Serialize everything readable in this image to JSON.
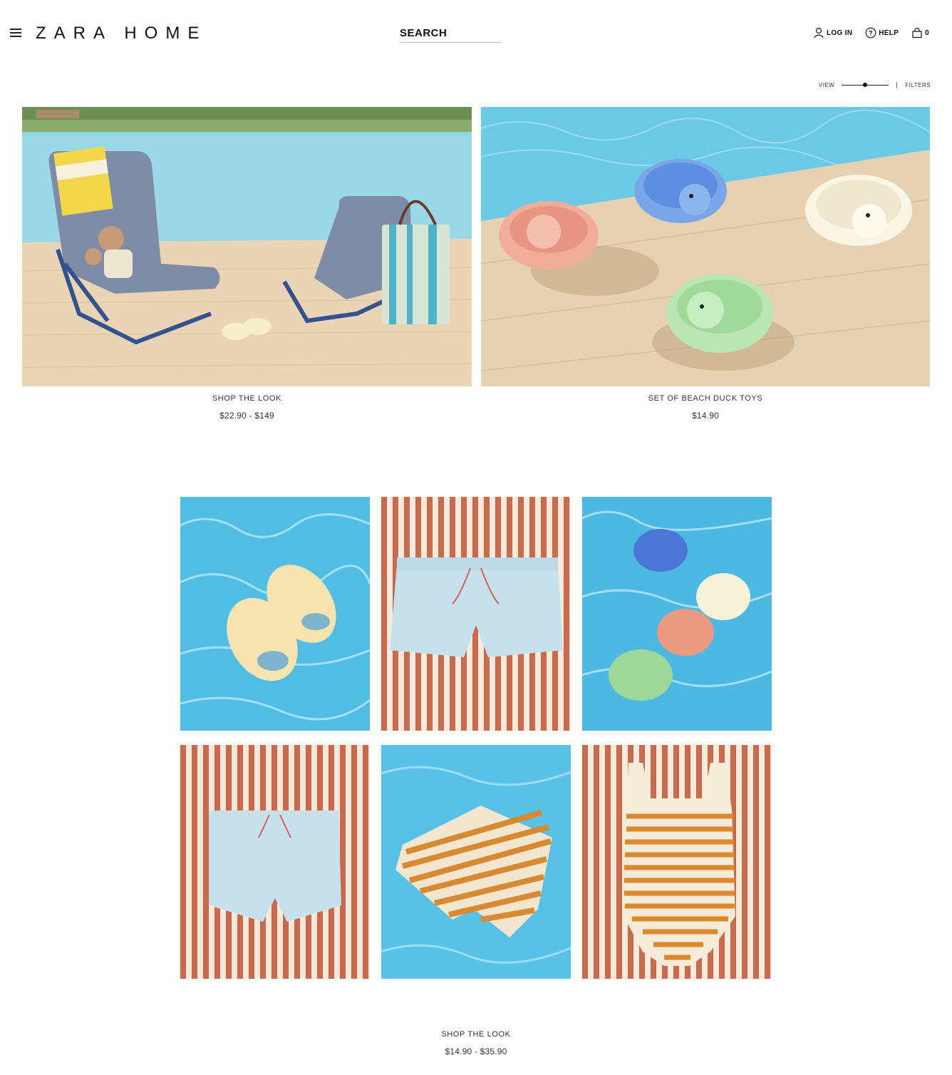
{
  "header": {
    "logo": "ZARA HOME",
    "search_label": "SEARCH",
    "login_label": "LOG IN",
    "help_label": "HELP",
    "cart_count": "0"
  },
  "viewbar": {
    "view_label": "VIEW",
    "separator": "|",
    "filters_label": "FILTERS",
    "zoom_level": 0.5
  },
  "products": [
    {
      "name": "SHOP THE LOOK",
      "price": "$22.90 - $149",
      "image": "beach-chairs-pool"
    },
    {
      "name": "SET OF BEACH DUCK TOYS",
      "price": "$14.90",
      "image": "duck-toys-pool-deck"
    }
  ],
  "look": {
    "name": "SHOP THE LOOK",
    "price": "$14.90 - $35.90",
    "images": [
      "clogs-in-pool",
      "swim-shorts-on-stripes",
      "duck-toys-in-pool",
      "swim-briefs-on-stripes",
      "striped-shorts-in-pool",
      "striped-swimsuit-on-stripes"
    ]
  },
  "colors": {
    "pool": "#5cc4e6",
    "deck": "#e8d3b4",
    "stripe_rust": "#c96a4e",
    "stripe_cream": "#f7ead9"
  }
}
